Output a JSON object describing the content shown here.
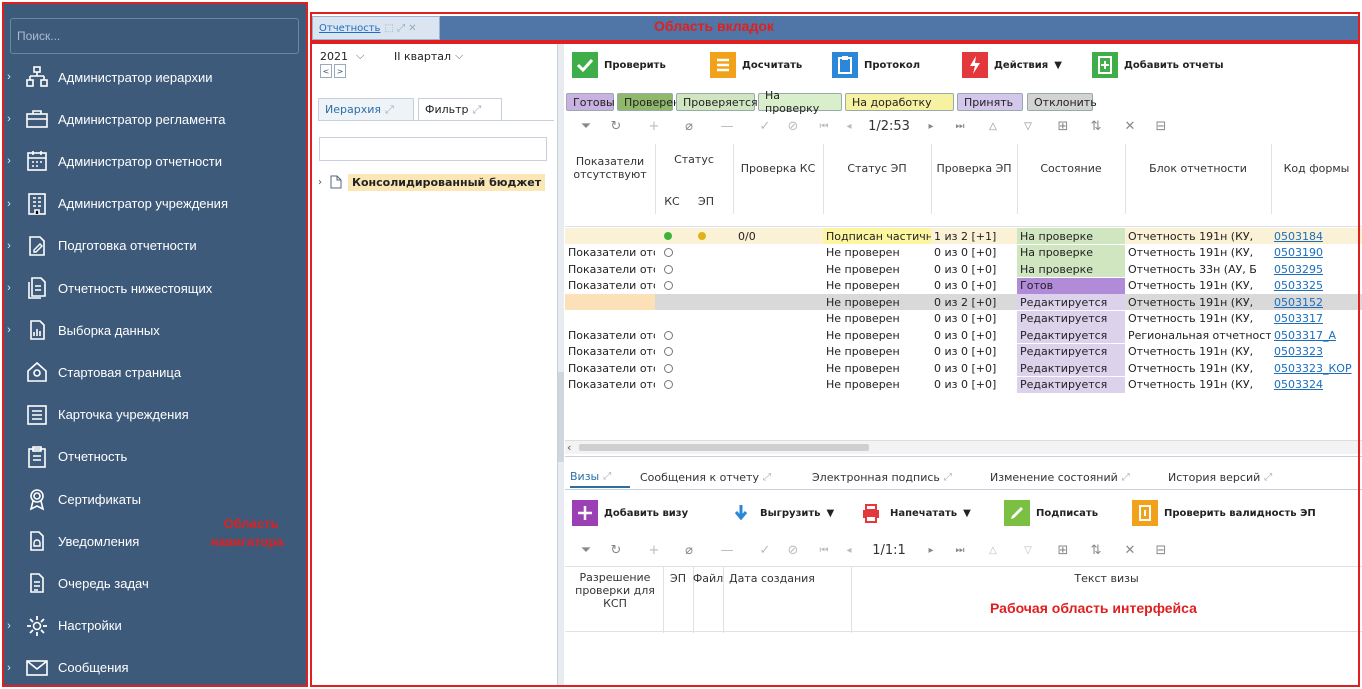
{
  "sidebar": {
    "search_placeholder": "Поиск...",
    "items": [
      {
        "label": "Администратор иерархии",
        "expandable": true,
        "icon": "hierarchy-icon"
      },
      {
        "label": "Администратор регламента",
        "expandable": true,
        "icon": "briefcase-icon"
      },
      {
        "label": "Администратор отчетности",
        "expandable": true,
        "icon": "calendar-icon"
      },
      {
        "label": "Администратор учреждения",
        "expandable": true,
        "icon": "building-icon"
      },
      {
        "label": "Подготовка отчетности",
        "expandable": true,
        "icon": "document-edit-icon"
      },
      {
        "label": "Отчетность нижестоящих",
        "expandable": true,
        "icon": "documents-icon"
      },
      {
        "label": "Выборка данных",
        "expandable": true,
        "icon": "data-selection-icon"
      },
      {
        "label": "Стартовая страница",
        "expandable": false,
        "icon": "home-icon"
      },
      {
        "label": "Карточка учреждения",
        "expandable": false,
        "icon": "card-icon"
      },
      {
        "label": "Отчетность",
        "expandable": false,
        "icon": "clipboard-icon"
      },
      {
        "label": "Сертификаты",
        "expandable": false,
        "icon": "certificate-icon"
      },
      {
        "label": "Уведомления",
        "expandable": false,
        "icon": "notification-icon"
      },
      {
        "label": "Очередь задач",
        "expandable": false,
        "icon": "queue-icon"
      },
      {
        "label": "Настройки",
        "expandable": true,
        "icon": "gear-icon"
      },
      {
        "label": "Сообщения",
        "expandable": true,
        "icon": "envelope-icon"
      }
    ]
  },
  "annotations": {
    "tabs_area": "Область вкладок",
    "navigator_area_line1": "Область",
    "navigator_area_line2": "навигатора",
    "work_area": "Рабочая область интерфейса"
  },
  "tabs": [
    {
      "label": "Отчетность"
    }
  ],
  "left_panel": {
    "year": "2021",
    "quarter": "II квартал",
    "tab_hierarchy": "Иерархия",
    "tab_filter": "Фильтр",
    "tree_node": "Консолидированный бюджет"
  },
  "toolbar": {
    "check": "Проверить",
    "recalc": "Досчитать",
    "protocol": "Протокол",
    "actions": "Действия",
    "add_reports": "Добавить отчеты"
  },
  "filters": [
    {
      "label": "Готовы",
      "bg": "#c9b2e2"
    },
    {
      "label": "Проверен",
      "bg": "#8fb86a"
    },
    {
      "label": "Проверяется",
      "bg": "#cfe6c0"
    },
    {
      "label": "На проверку",
      "bg": "#d9eecb"
    },
    {
      "label": "На доработку",
      "bg": "#f6f2a2"
    },
    {
      "label": "Принять",
      "bg": "#d4c7ec"
    },
    {
      "label": "Отклонить",
      "bg": "#d3d3d3"
    }
  ],
  "pagination": {
    "top": "1/2:53",
    "bottom": "1/1:1"
  },
  "grid": {
    "headers": {
      "indicators": "Показатели отсутствуют",
      "status": "Статус",
      "ks": "КС",
      "ep": "ЭП",
      "check_ks": "Проверка КС",
      "status_ep": "Статус ЭП",
      "check_ep": "Проверка ЭП",
      "state": "Состояние",
      "block": "Блок отчетности",
      "form_code": "Код формы"
    },
    "rows": [
      {
        "ind": "",
        "ks": "green",
        "ep": "yellow",
        "chk": "0/0",
        "sep": "Подписан частично",
        "cep": "1 из 2 [+1]",
        "state": "На проверке",
        "block": "Отчетность 191н (КУ, ",
        "code": "0503184",
        "bg": "#fbf1d6",
        "sepbg": "#fcf6a0",
        "stbg": "#cfe6c0"
      },
      {
        "ind": "Показатели отсутствуют",
        "ks": "circle",
        "ep": "",
        "chk": "",
        "sep": "Не проверен",
        "cep": "0 из 0 [+0]",
        "state": "На проверке",
        "block": "Отчетность 191н (КУ, ",
        "code": "0503190",
        "bg": "#fff",
        "sepbg": "",
        "stbg": "#cfe6c0"
      },
      {
        "ind": "Показатели отсутствуют",
        "ks": "circle",
        "ep": "",
        "chk": "",
        "sep": "Не проверен",
        "cep": "0 из 0 [+0]",
        "state": "На проверке",
        "block": "Отчетность 33н (АУ, Б",
        "code": "0503295",
        "bg": "#fff",
        "sepbg": "",
        "stbg": "#cfe6c0"
      },
      {
        "ind": "Показатели отсутствуют",
        "ks": "circle",
        "ep": "",
        "chk": "",
        "sep": "Не проверен",
        "cep": "0 из 0 [+0]",
        "state": "Готов",
        "block": "Отчетность 191н (КУ, ",
        "code": "0503325",
        "bg": "#fff",
        "sepbg": "",
        "stbg": "#b18ad8"
      },
      {
        "ind": "",
        "ks": "",
        "ep": "",
        "chk": "",
        "sep": "Не проверен",
        "cep": "0 из 2 [+0]",
        "state": "Редактируется",
        "block": "Отчетность 191н (КУ, ",
        "code": "0503152",
        "bg": "#d9d9d9",
        "sepbg": "",
        "stbg": "#dcd2ec",
        "leftbg": "#fbe0b8"
      },
      {
        "ind": "",
        "ks": "",
        "ep": "",
        "chk": "",
        "sep": "Не проверен",
        "cep": "0 из 0 [+0]",
        "state": "Редактируется",
        "block": "Отчетность 191н (КУ, ",
        "code": "0503317",
        "bg": "#fff",
        "sepbg": "",
        "stbg": "#dcd2ec"
      },
      {
        "ind": "Показатели отсутствуют",
        "ks": "circle",
        "ep": "",
        "chk": "",
        "sep": "Не проверен",
        "cep": "0 из 0 [+0]",
        "state": "Редактируется",
        "block": "Региональная отчетность",
        "code": "0503317_А",
        "bg": "#fff",
        "sepbg": "",
        "stbg": "#dcd2ec"
      },
      {
        "ind": "Показатели отсутствуют",
        "ks": "circle",
        "ep": "",
        "chk": "",
        "sep": "Не проверен",
        "cep": "0 из 0 [+0]",
        "state": "Редактируется",
        "block": "Отчетность 191н (КУ, ",
        "code": "0503323",
        "bg": "#fff",
        "sepbg": "",
        "stbg": "#dcd2ec"
      },
      {
        "ind": "Показатели отсутствуют",
        "ks": "circle",
        "ep": "",
        "chk": "",
        "sep": "Не проверен",
        "cep": "0 из 0 [+0]",
        "state": "Редактируется",
        "block": "Отчетность 191н (КУ, ",
        "code": "0503323_КОР",
        "bg": "#fff",
        "sepbg": "",
        "stbg": "#dcd2ec"
      },
      {
        "ind": "Показатели отсутствуют",
        "ks": "circle",
        "ep": "",
        "chk": "",
        "sep": "Не проверен",
        "cep": "0 из 0 [+0]",
        "state": "Редактируется",
        "block": "Отчетность 191н (КУ, ",
        "code": "0503324",
        "bg": "#fff",
        "sepbg": "",
        "stbg": "#dcd2ec"
      }
    ]
  },
  "bottom": {
    "tabs": [
      "Визы",
      "Сообщения к отчету",
      "Электронная подпись",
      "Изменение состояний",
      "История версий"
    ],
    "toolbar": {
      "add_visa": "Добавить визу",
      "export": "Выгрузить",
      "print": "Напечатать",
      "sign": "Подписать",
      "validate_ep": "Проверить валидность ЭП"
    },
    "headers": {
      "permission": "Разрешение проверки для КСП",
      "ep": "ЭП",
      "file": "Файл",
      "created": "Дата создания",
      "visa_text": "Текст визы"
    }
  }
}
